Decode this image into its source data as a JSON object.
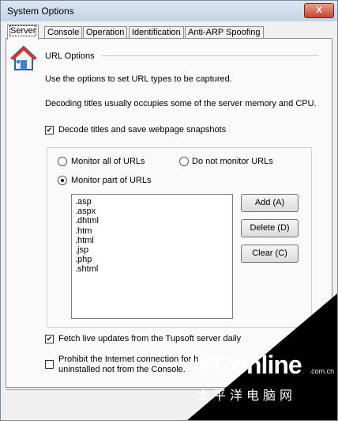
{
  "window": {
    "title": "System Options",
    "close_label": "X"
  },
  "tabs": [
    {
      "label": "Server",
      "active": true
    },
    {
      "label": "Console"
    },
    {
      "label": "Operation"
    },
    {
      "label": "Identification"
    },
    {
      "label": "Anti-ARP Spoofing"
    }
  ],
  "section": {
    "title": "URL Options",
    "icon": "home-icon"
  },
  "descriptions": {
    "line1": "Use the options to set URL types to be captured.",
    "line2": "Decoding titles usually occupies some of the server memory and CPU."
  },
  "decode_titles": {
    "label": "Decode titles and save webpage snapshots",
    "checked": true
  },
  "radios": {
    "all": {
      "label": "Monitor all of URLs",
      "selected": false
    },
    "none": {
      "label": "Do not monitor URLs",
      "selected": false
    },
    "part": {
      "label": "Monitor part of URLs",
      "selected": true
    }
  },
  "url_types": [
    ".asp",
    ".aspx",
    ".dhtml",
    ".htm",
    ".html",
    ".jsp",
    ".php",
    ".shtml"
  ],
  "buttons": {
    "add": "Add (A)",
    "delete": "Delete (D)",
    "clear": "Clear (C)"
  },
  "fetch_updates": {
    "label": "Fetch live updates from the Tupsoft server daily",
    "checked": true
  },
  "prohibit": {
    "line1": "Prohibit the Internet connection for h",
    "line2": "uninstalled not from the Console.",
    "checked": false
  },
  "watermark": {
    "brand": "PConline",
    "domain": ".com.cn",
    "chinese": "太平洋电脑网"
  }
}
